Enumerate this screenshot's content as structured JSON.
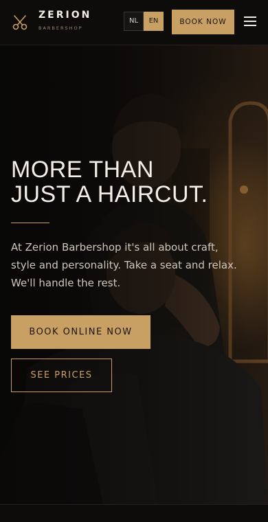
{
  "header": {
    "brand_name": "ZERION",
    "brand_sub": "BARBERSHOP",
    "logo_icon": "scissors-icon",
    "languages": [
      {
        "code": "NL",
        "active": false
      },
      {
        "code": "EN",
        "active": true
      }
    ],
    "book_now_label": "BOOK NOW",
    "menu_icon": "hamburger-menu-icon"
  },
  "hero": {
    "title_line1": "MORE THAN",
    "title_line2": "JUST A HAIRCUT.",
    "description": "At Zerion Barbershop it's all about craft, style and personality. Take a seat and relax. We'll handle the rest.",
    "primary_cta": "BOOK ONLINE NOW",
    "secondary_cta": "SEE PRICES",
    "background": "barber-cutting-hair-photo"
  },
  "colors": {
    "accent": "#c9a064",
    "background": "#0b0a09",
    "text": "#f3efe8"
  }
}
